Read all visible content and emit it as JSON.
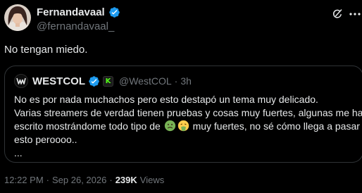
{
  "author": {
    "display_name": "Fernandavaal",
    "handle": "@fernandavaal_",
    "verified_icon": "verified-badge-icon"
  },
  "tweet": {
    "text": "No tengan miedo."
  },
  "actions": {
    "grok_icon": "grok-icon",
    "more_icon": "more-options-icon"
  },
  "quoted": {
    "display_name": "WESTCOL",
    "handle": "@WestCOL",
    "separator": "·",
    "time": "3h",
    "affiliation_icon": "kick-badge-icon",
    "lines": [
      "No es por nada muchachos pero esto destapó un tema muy delicado.",
      "Varias streamers de verdad tienen pruebas y cosas muy fuertes, algunas me han",
      "escrito mostrándome todo tipo de",
      "muy fuertes, no sé cómo llega a pasar",
      "esto peroooo..",
      "..."
    ],
    "emojis": [
      "nauseated-face-emoji",
      "vomiting-face-emoji"
    ]
  },
  "meta": {
    "time": "12:22 PM",
    "separator": "·",
    "date": "Sep 26, 2026",
    "views_count": "239K",
    "views_label": "Views"
  },
  "colors": {
    "background": "#000000",
    "text_primary": "#e7e9ea",
    "text_secondary": "#71767b",
    "border": "#2f3336",
    "verified_blue": "#1d9bf0",
    "kick_green": "#53fc18"
  }
}
